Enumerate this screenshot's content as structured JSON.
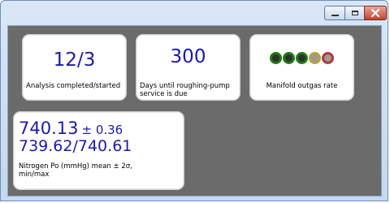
{
  "window_controls": {
    "minimize_symbol": "–",
    "maximize_symbol": "□",
    "close_symbol": "✕"
  },
  "tiles": {
    "analysis": {
      "value": "12/3",
      "label": "Analysis completed/started"
    },
    "pump": {
      "value": "300",
      "label": "Days until roughing-pump service is due"
    },
    "manifold": {
      "label": "Manifold outgas rate",
      "indicators": [
        {
          "color": "green",
          "state": "on"
        },
        {
          "color": "green",
          "state": "on"
        },
        {
          "color": "green",
          "state": "on"
        },
        {
          "color": "yellow",
          "state": "off"
        },
        {
          "color": "red",
          "state": "off"
        }
      ]
    },
    "nitrogen": {
      "mean": "740.13",
      "sigma": "± 0.36",
      "minmax": "739.62/740.61",
      "label": "Nitrogen Po (mmHg) mean ± 2σ, min/max"
    }
  },
  "colors": {
    "value_text": "#1a1aa6",
    "panel_background": "#6b6b6b"
  }
}
